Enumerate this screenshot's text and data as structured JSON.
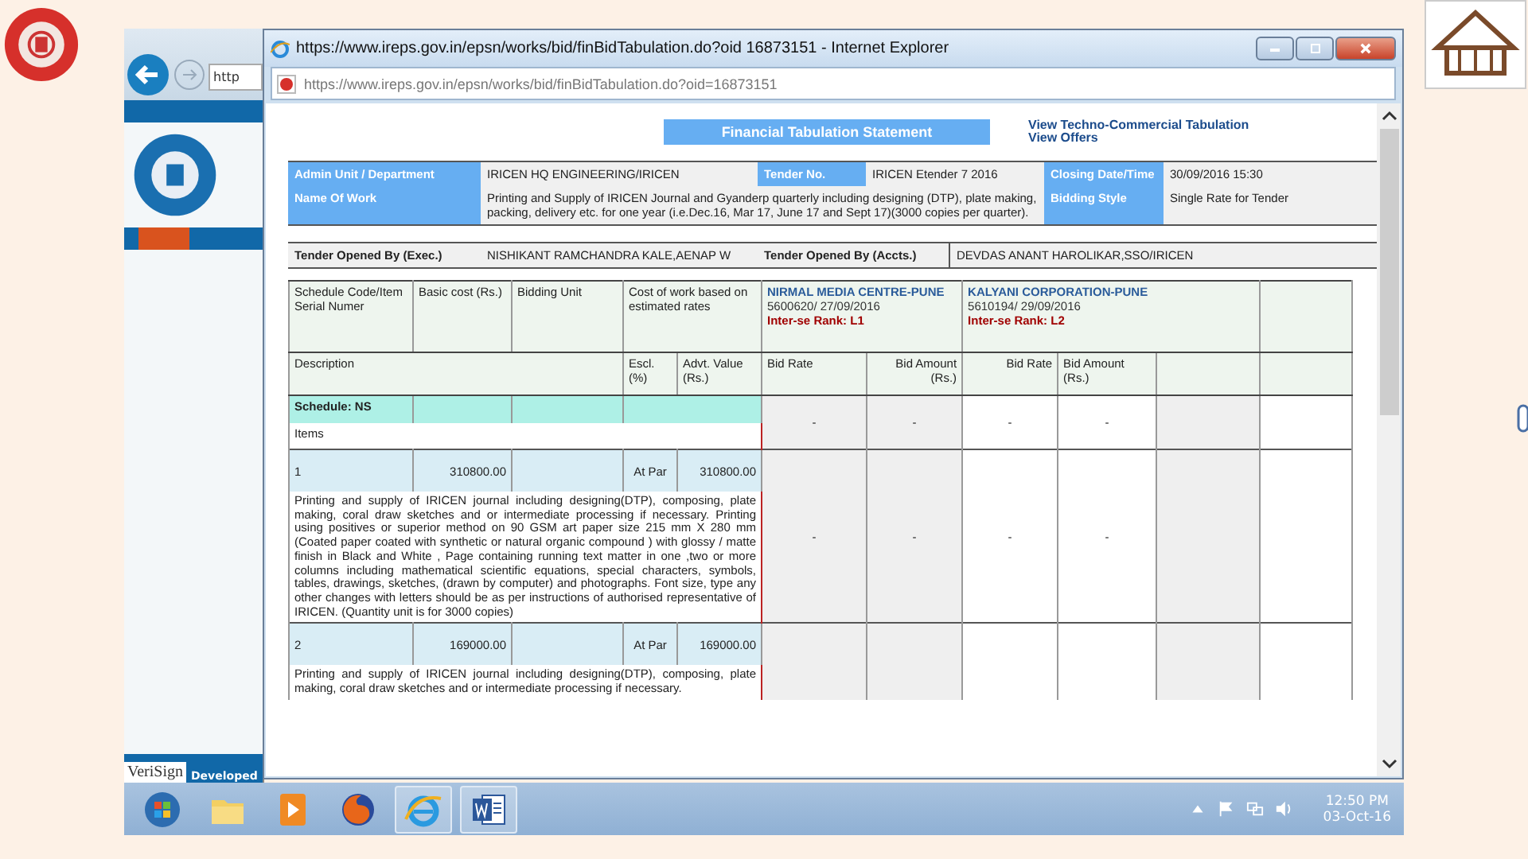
{
  "background_window": {
    "address_partial": "http",
    "verisign": "VeriSign",
    "footer_partial": "Developed"
  },
  "popup": {
    "title": "https://www.ireps.gov.in/epsn/works/bid/finBidTabulation.do?oid 16873151 - Internet Explorer",
    "address": "https://www.ireps.gov.in/epsn/works/bid/finBidTabulation.do?oid=16873151"
  },
  "page": {
    "heading": "Financial Tabulation Statement",
    "links": [
      "View Techno-Commercial Tabulation",
      "View Offers"
    ],
    "info": {
      "admin_label": "Admin Unit / Department",
      "admin_value": "IRICEN HQ ENGINEERING/IRICEN",
      "tender_label": "Tender No.",
      "tender_value": "IRICEN Etender 7 2016",
      "closing_label": "Closing Date/Time",
      "closing_value": "30/09/2016 15:30",
      "work_label": "Name Of Work",
      "work_value": "Printing and Supply of IRICEN Journal and Gyanderp quarterly including designing (DTP), plate making, packing, delivery etc. for one year (i.e.Dec.16, Mar 17, June 17 and Sept 17)(3000 copies per quarter).",
      "style_label": "Bidding Style",
      "style_value": "Single Rate for Tender"
    },
    "opened": [
      {
        "label": "Tender Opened By (Exec.)",
        "value": "NISHIKANT RAMCHANDRA KALE,AENAP W"
      },
      {
        "label": "Tender Opened By (Accts.)",
        "value": "DEVDAS ANANT HAROLIKAR,SSO/IRICEN"
      }
    ],
    "table": {
      "columns_top": [
        "Schedule Code/Item Serial Numer",
        "Basic cost (Rs.)",
        "Bidding Unit",
        "Cost of work based on estimated rates"
      ],
      "bidders": [
        {
          "name": "NIRMAL MEDIA CENTRE-PUNE",
          "ref": "5600620/ 27/09/2016",
          "rank": "Inter-se Rank: L1"
        },
        {
          "name": "KALYANI CORPORATION-PUNE",
          "ref": "5610194/ 29/09/2016",
          "rank": "Inter-se Rank: L2"
        }
      ],
      "description_header": "Description",
      "escl_header": "Escl. (%)",
      "advt_header": "Advt. Value (Rs.)",
      "bid_headers": [
        "Bid Rate",
        "Bid Amount (Rs.)",
        "Bid Rate",
        "Bid Amount (Rs.)"
      ],
      "schedule": "Schedule: NS",
      "items_label": "Items",
      "schedule_bids": [
        "-",
        "-",
        "-",
        "-"
      ],
      "items": [
        {
          "serial": "1",
          "basic": "310800.00",
          "rate": "At Par",
          "value": "310800.00",
          "description": "Printing and supply of IRICEN journal including designing(DTP), composing, plate making, coral draw sketches and or intermediate processing if necessary. Printing using positives or superior method on 90 GSM art paper size 215 mm X 280 mm (Coated paper coated with synthetic or natural organic compound ) with glossy / matte finish in Black and White , Page containing running text matter in one ,two or more columns including mathematical scientific equations, special characters, symbols, tables, drawings, sketches, (drawn by computer) and photographs. Font size, type any other changes with letters should be as per instructions of authorised representative of IRICEN. (Quantity unit is for 3000 copies)",
          "bids": [
            "-",
            "-",
            "-",
            "-"
          ]
        },
        {
          "serial": "2",
          "basic": "169000.00",
          "rate": "At Par",
          "value": "169000.00",
          "description": "Printing and supply of IRICEN journal including designing(DTP), composing, plate making, coral draw sketches and or intermediate processing if necessary."
        }
      ]
    }
  },
  "taskbar": {
    "apps": [
      {
        "kind": "start",
        "open": false
      },
      {
        "kind": "folder",
        "open": false
      },
      {
        "kind": "media",
        "open": false
      },
      {
        "kind": "firefox",
        "open": false
      },
      {
        "kind": "ie",
        "open": true
      },
      {
        "kind": "word",
        "open": true
      }
    ],
    "time": "12:50 PM",
    "date": "03-Oct-16"
  }
}
